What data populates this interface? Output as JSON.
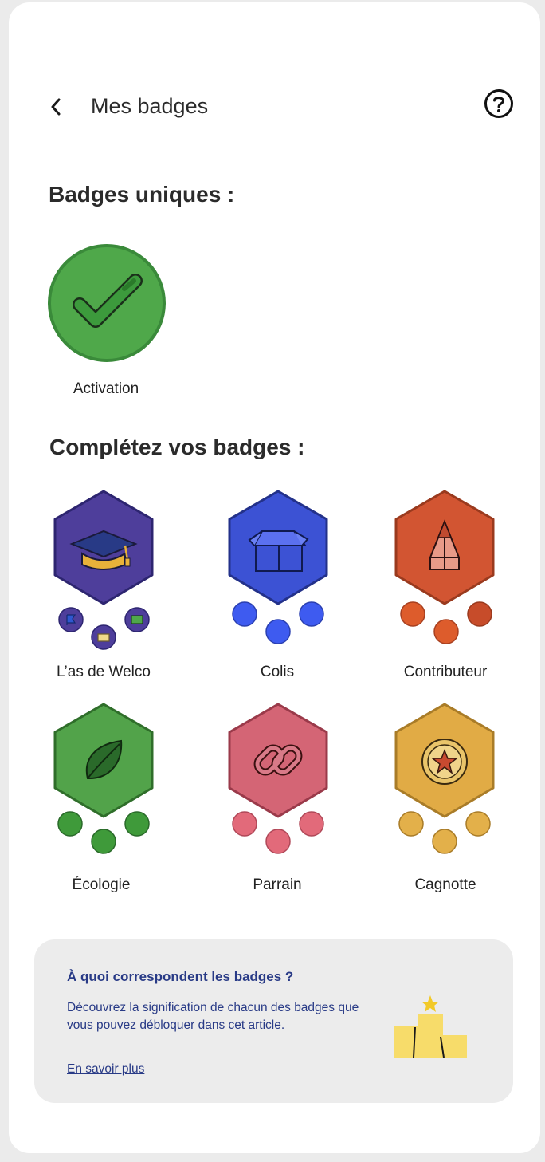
{
  "header": {
    "title": "Mes badges"
  },
  "unique_section": {
    "title": "Badges uniques :",
    "badges": [
      {
        "label": "Activation",
        "color": "#4fa84a"
      }
    ]
  },
  "complete_section": {
    "title": "Complétez vos badges :",
    "badges": [
      {
        "label": "L’as de Welco",
        "color": "#4e3e9b"
      },
      {
        "label": "Colis",
        "color": "#3c52d4"
      },
      {
        "label": "Contributeur",
        "color": "#d25532"
      },
      {
        "label": "Écologie",
        "color": "#52a34a"
      },
      {
        "label": "Parrain",
        "color": "#d46575"
      },
      {
        "label": "Cagnotte",
        "color": "#e1ab45"
      }
    ]
  },
  "info": {
    "title": "À quoi correspondent les badges ?",
    "description": "Découvrez la signification de chacun des badges que vous pouvez débloquer dans cet article.",
    "link": "En savoir plus"
  }
}
